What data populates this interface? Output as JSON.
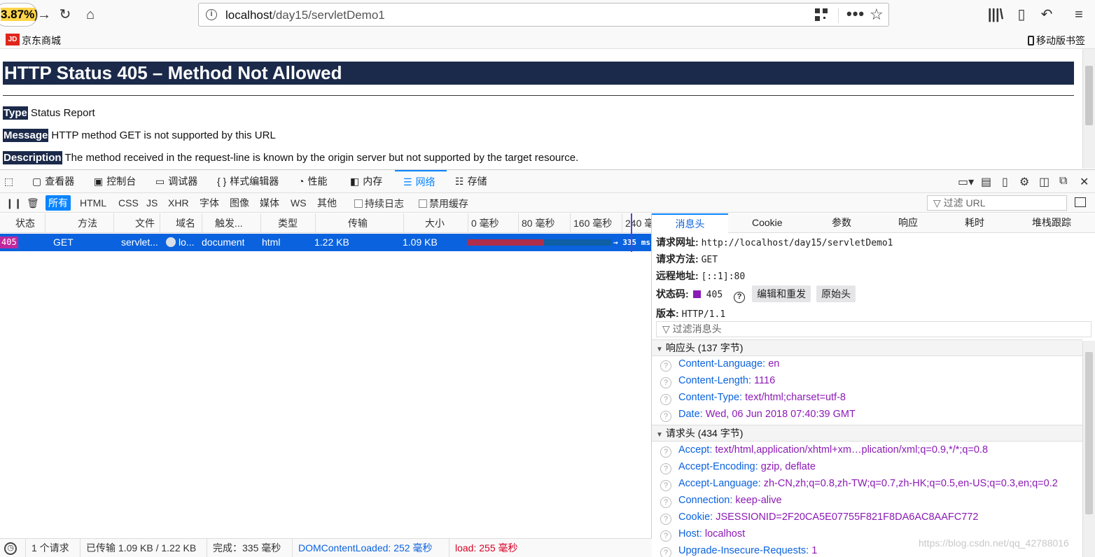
{
  "browser": {
    "zoom_badge": "3.87%)",
    "url_prefix": "localhost",
    "url_path": "/day15/servletDemo1",
    "bookmark_label": "京东商城",
    "bookmark_logo": "JD",
    "mobile_bookmarks": "移动版书签",
    "icons": [
      "back-arrow-icon",
      "reload-icon",
      "home-icon",
      "info-icon",
      "qr-code-icon",
      "more-icon",
      "star-icon",
      "library-icon",
      "sidebar-icon",
      "undo-icon",
      "menu-icon"
    ]
  },
  "page": {
    "title": "HTTP Status 405 – Method Not Allowed",
    "type_label": "Type",
    "type_value": "Status Report",
    "message_label": "Message",
    "message_value": "HTTP method GET is not supported by this URL",
    "description_label": "Description",
    "description_value": "The method received in the request-line is known by the origin server but not supported by the target resource."
  },
  "devtools": {
    "tabs": [
      "查看器",
      "控制台",
      "调试器",
      "样式编辑器",
      "性能",
      "内存",
      "网络",
      "存储"
    ],
    "active_tab": "网络",
    "filter_buttons": [
      "所有",
      "HTML",
      "CSS",
      "JS",
      "XHR",
      "字体",
      "图像",
      "媒体",
      "WS",
      "其他"
    ],
    "persist_logs": "持续日志",
    "disable_cache": "禁用缓存",
    "url_filter_placeholder": "过滤 URL",
    "columns": [
      "状态",
      "方法",
      "文件",
      "域名",
      "触发...",
      "类型",
      "传输",
      "大小",
      "0 毫秒",
      "80 毫秒",
      "160 毫秒",
      "240 毫"
    ],
    "request": {
      "status": "405",
      "method": "GET",
      "file": "servlet...",
      "domain": "lo...",
      "cause": "document",
      "type": "html",
      "transferred": "1.22 KB",
      "size": "1.09 KB",
      "timing": "→ 335 ms"
    },
    "statusbar": {
      "requests": "1 个请求",
      "transferred": "已传输 1.09 KB / 1.22 KB",
      "finish": "完成：335 毫秒",
      "dom_loaded": "DOMContentLoaded: 252 毫秒",
      "load": "load: 255 毫秒"
    },
    "details": {
      "tabs": [
        "消息头",
        "Cookie",
        "参数",
        "响应",
        "耗时",
        "堆栈跟踪"
      ],
      "active_tab": "消息头",
      "request_url_label": "请求网址:",
      "request_url": "http://localhost/day15/servletDemo1",
      "method_label": "请求方法:",
      "method": "GET",
      "remote_label": "远程地址:",
      "remote": "[::1]:80",
      "status_label": "状态码:",
      "status": "405",
      "edit_resend": "编辑和重发",
      "raw_headers": "原始头",
      "version_label": "版本:",
      "version": "HTTP/1.1",
      "filter_placeholder": "过滤消息头",
      "response_section": "响应头 (137 字节)",
      "response_headers": [
        {
          "name": "Content-Language:",
          "value": "en"
        },
        {
          "name": "Content-Length:",
          "value": "1116"
        },
        {
          "name": "Content-Type:",
          "value": "text/html;charset=utf-8"
        },
        {
          "name": "Date:",
          "value": "Wed, 06 Jun 2018 07:40:39 GMT"
        }
      ],
      "request_section": "请求头 (434 字节)",
      "request_headers": [
        {
          "name": "Accept:",
          "value": "text/html,application/xhtml+xm…plication/xml;q=0.9,*/*;q=0.8"
        },
        {
          "name": "Accept-Encoding:",
          "value": "gzip, deflate"
        },
        {
          "name": "Accept-Language:",
          "value": "zh-CN,zh;q=0.8,zh-TW;q=0.7,zh-HK;q=0.5,en-US;q=0.3,en;q=0.2"
        },
        {
          "name": "Connection:",
          "value": "keep-alive"
        },
        {
          "name": "Cookie:",
          "value": "JSESSIONID=2F20CA5E07755F821F8DA6AC8AAFC772"
        },
        {
          "name": "Host:",
          "value": "localhost"
        },
        {
          "name": "Upgrade-Insecure-Requests:",
          "value": "1"
        }
      ]
    },
    "watermark": "https://blog.csdn.net/qq_42788016"
  },
  "colors": {
    "title_bg": "#1b2a4a",
    "accent": "#0a84ff",
    "selected_row": "#0a62de",
    "status_badge": "#c1279d"
  }
}
